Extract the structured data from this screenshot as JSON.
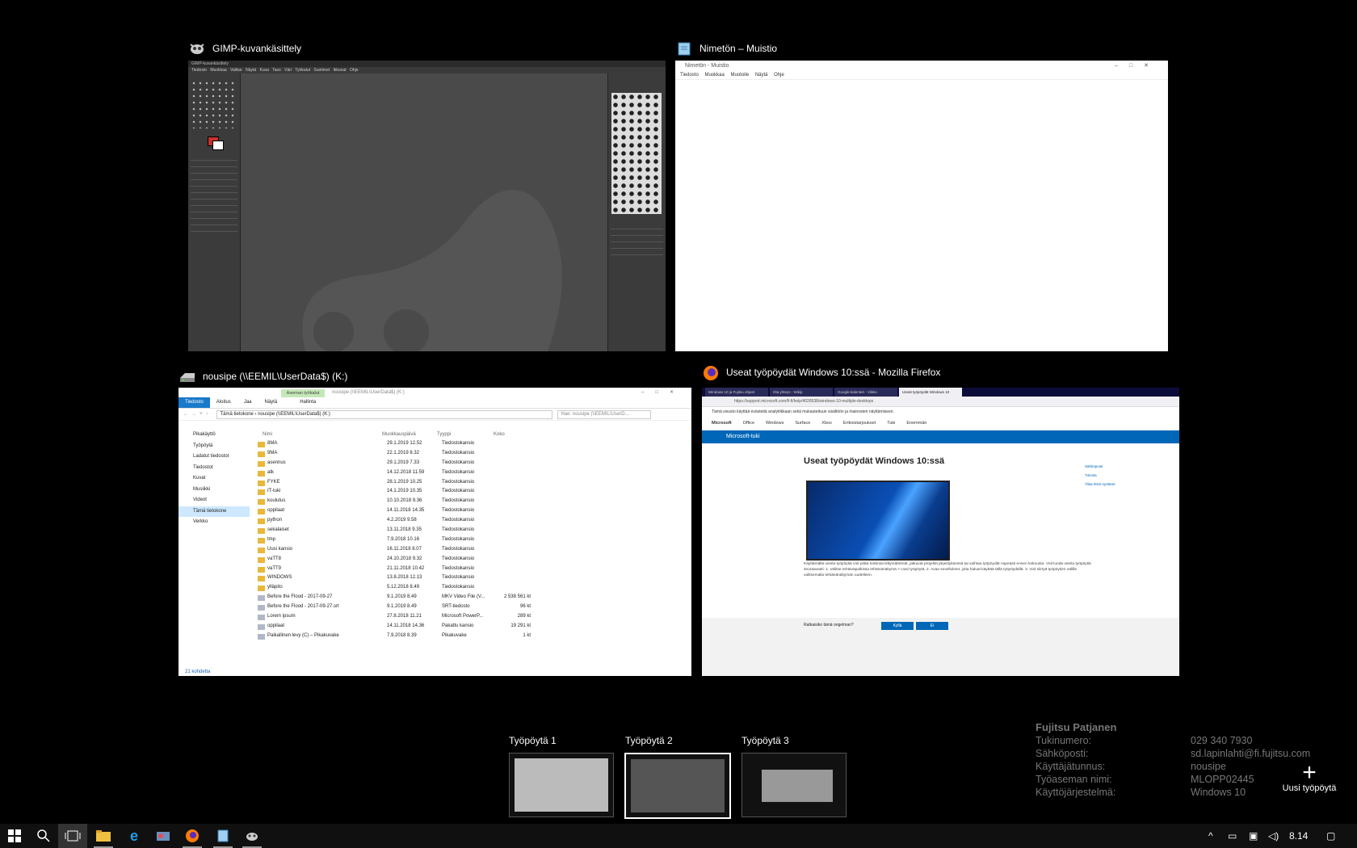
{
  "windows": {
    "gimp": {
      "title": "GIMP-kuvankäsittely",
      "titlebar": "GIMP-kuvankäsittely",
      "menu": "Tiedosto Muokkaa Valitse Näytä Kuva Taso Väri Työkalut Suotimet Ikkunat Ohje"
    },
    "notepad": {
      "title": "Nimetön – Muistio",
      "titlebar": "Nimetön - Muistio",
      "menu": "Tiedosto Muokkaa Muotoile Näytä Ohje"
    },
    "explorer": {
      "title": "nousipe (\\\\EEMIL\\UserData$) (K:)",
      "titlebar": "nousipe (\\\\EEMIL\\UserData$) (K:)",
      "context_tab": "Aseman työkalut",
      "ribbon": [
        "Tiedosto",
        "Aloitus",
        "Jaa",
        "Näytä",
        "Hallinta"
      ],
      "address": "Tämä tietokone › nousipe (\\\\EEMIL\\UserData$) (K:)",
      "search_placeholder": "Hae: nousipe (\\\\EEMIL\\UserD...",
      "nav": [
        "Pikakäyttö",
        "Työpöytä",
        "Ladatut tiedostot",
        "Tiedostot",
        "Kuvat",
        "Musiikki",
        "Videot",
        "Tämä tietokone",
        "Verkko"
      ],
      "columns": [
        "Nimi",
        "Muokkauspäivä",
        "Tyyppi",
        "Koko"
      ],
      "rows": [
        [
          "8MA",
          "29.1.2019 12.52",
          "Tiedostokansio",
          ""
        ],
        [
          "9MA",
          "22.1.2019 8.32",
          "Tiedostokansio",
          ""
        ],
        [
          "asennus",
          "29.1.2019 7.33",
          "Tiedostokansio",
          ""
        ],
        [
          "atk",
          "14.12.2018 11.59",
          "Tiedostokansio",
          ""
        ],
        [
          "FYKE",
          "28.1.2019 10.25",
          "Tiedostokansio",
          ""
        ],
        [
          "IT-tuki",
          "14.1.2019 10.35",
          "Tiedostokansio",
          ""
        ],
        [
          "koulutus",
          "10.10.2018 9.36",
          "Tiedostokansio",
          ""
        ],
        [
          "oppilaat",
          "14.11.2018 14.35",
          "Tiedostokansio",
          ""
        ],
        [
          "python",
          "4.2.2019 9.58",
          "Tiedostokansio",
          ""
        ],
        [
          "sekalaiset",
          "13.11.2018 9.35",
          "Tiedostokansio",
          ""
        ],
        [
          "tmp",
          "7.9.2018 10.16",
          "Tiedostokansio",
          ""
        ],
        [
          "Uusi kansio",
          "16.11.2018 8.07",
          "Tiedostokansio",
          ""
        ],
        [
          "vaTT8",
          "24.10.2018 9.32",
          "Tiedostokansio",
          ""
        ],
        [
          "vaTT9",
          "21.11.2018 10.42",
          "Tiedostokansio",
          ""
        ],
        [
          "WINDOWS",
          "13.8.2018 12.13",
          "Tiedostokansio",
          ""
        ],
        [
          "ylläpito",
          "5.12.2018 8.49",
          "Tiedostokansio",
          ""
        ],
        [
          "Before the Flood - 2017-09-27",
          "9.1.2019 8.49",
          "MKV Video File (V...",
          "2 538 561 kt"
        ],
        [
          "Before the Flood - 2017-09-27.srt",
          "9.1.2019 8.49",
          "SRT-tiedosto",
          "96 kt"
        ],
        [
          "Lorem ipsum",
          "27.8.2018 11.21",
          "Microsoft PowerP...",
          "289 kt"
        ],
        [
          "oppilaat",
          "14.11.2018 14.36",
          "Pakattu kansio",
          "19 291 kt"
        ],
        [
          "Paikallinen levy (C) – Pikakuvake",
          "7.9.2018 8.39",
          "Pikakuvake",
          "1 kt"
        ]
      ],
      "status": "21 kohdetta"
    },
    "firefox": {
      "title": "Useat työpöydät Windows 10:ssä - Mozilla Firefox",
      "tabs": [
        "Windows 10 ja Fujitsu ohjeet",
        "Ota yhteys - Wikip",
        "Google-kalenteri - Viikko",
        "Useat työpöydät Windows 10"
      ],
      "url": "https://support.microsoft.com/fi-fi/help/4028538/windows-10-multiple-desktops",
      "cookie": "Tämä sivusto käyttää evästeitä analytiikkaan sekä mukautettuun sisältöön ja mainosten näyttämiseen.",
      "nav": [
        "Microsoft",
        "Office",
        "Windows",
        "Surface",
        "Xbox",
        "Erikoistarjoukset",
        "Tuki",
        "Enemmän"
      ],
      "bluebar": "Microsoft-tuki",
      "heading": "Useat työpöydät Windows 10:ssä",
      "para": "Käyttämällä useita työpöytiä voit pitää toisiinsa liittymättömät, jatkuvat projektit järjestyksessä tai vaihtaa työpöydät nopeasti ennen kokousta. Voit luoda useita työpöytiä seuraavasti: 1. Valitse tehtäväpalkissa tehtävänäkymä > Uusi työpöytä. 2. Avaa sovellukset, joita haluat käyttää tällä työpöydällä. 3. Voit siirtyä työpöytien välillä valitsemalla tehtävänäkymän uudelleen.",
      "feedback": "Ratkaisiko tämä ongelman?",
      "yes": "Kyllä",
      "no": "Ei",
      "side": [
        "Sähköposti",
        "Tulosta",
        "Tilaa RSS-syötteet"
      ]
    }
  },
  "desktops": [
    {
      "label": "Työpöytä 1"
    },
    {
      "label": "Työpöytä 2"
    },
    {
      "label": "Työpöytä 3"
    }
  ],
  "info": {
    "title": "Fujitsu Patjanen",
    "rows": [
      {
        "k": "Tukinumero:",
        "v": "029 340 7930"
      },
      {
        "k": "Sähköposti:",
        "v": "sd.lapinlahti@fi.fujitsu.com"
      },
      {
        "k": "Käyttäjätunnus:",
        "v": "nousipe"
      },
      {
        "k": "Työaseman nimi:",
        "v": "MLOPP02445"
      },
      {
        "k": "Käyttöjärjestelmä:",
        "v": "Windows 10"
      }
    ]
  },
  "new_desktop": "Uusi työpöytä",
  "taskbar": {
    "clock": "8.14"
  },
  "colors": {
    "accent": "#0067b8",
    "gimp_fg": "#c8302c"
  }
}
